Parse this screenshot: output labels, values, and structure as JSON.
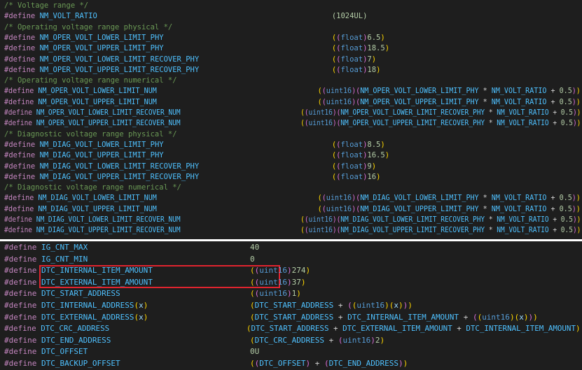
{
  "colors": {
    "background": "#1e1e1e",
    "comment": "#6a9955",
    "preprocessor": "#c586c0",
    "macro": "#4fc1ff",
    "number": "#b5cea8",
    "type": "#569cd6",
    "bracket": "#ffd700",
    "bracket_nested": "#da70d6",
    "operator": "#d4d4d4",
    "highlight_box": "#e0242f"
  },
  "editor_top": {
    "lines": [
      [
        {
          "t": "/* Voltage range */",
          "c": "comment"
        }
      ],
      [
        {
          "t": "#define",
          "c": "pp"
        },
        {
          "t": " NM_VOLT_RATIO",
          "c": "macro"
        },
        {
          "t": "(1024UL)",
          "c": "num",
          "col": 74
        }
      ],
      [
        {
          "t": "/* Operating voltage range physical */",
          "c": "comment"
        }
      ],
      [
        {
          "t": "#define",
          "c": "pp"
        },
        {
          "t": " NM_OPER_VOLT_LOWER_LIMIT_PHY",
          "c": "macro"
        },
        {
          "t": "((float)6.5)",
          "c": "expr",
          "col": 74
        }
      ],
      [
        {
          "t": "#define",
          "c": "pp"
        },
        {
          "t": " NM_OPER_VOLT_UPPER_LIMIT_PHY",
          "c": "macro"
        },
        {
          "t": "((float)18.5)",
          "c": "expr",
          "col": 74
        }
      ],
      [
        {
          "t": "#define",
          "c": "pp"
        },
        {
          "t": " NM_OPER_VOLT_LOWER_LIMIT_RECOVER_PHY",
          "c": "macro"
        },
        {
          "t": "((float)7)",
          "c": "expr",
          "col": 74
        }
      ],
      [
        {
          "t": "#define",
          "c": "pp"
        },
        {
          "t": " NM_OPER_VOLT_UPPER_LIMIT_RECOVER_PHY",
          "c": "macro"
        },
        {
          "t": "((float)18)",
          "c": "expr",
          "col": 74
        }
      ],
      [
        {
          "t": "/* Operating voltage range numerical */",
          "c": "comment"
        }
      ],
      [
        {
          "t": "#define",
          "c": "pp"
        },
        {
          "t": " NM_OPER_VOLT_LOWER_LIMIT_NUM",
          "c": "macro"
        },
        {
          "t": "((uint16)(NM_OPER_VOLT_LOWER_LIMIT_PHY * NM_VOLT_RATIO + 0.5))",
          "c": "expr",
          "col": 74
        }
      ],
      [
        {
          "t": "#define",
          "c": "pp"
        },
        {
          "t": " NM_OPER_VOLT_UPPER_LIMIT_NUM",
          "c": "macro"
        },
        {
          "t": "((uint16)(NM_OPER_VOLT_UPPER_LIMIT_PHY * NM_VOLT_RATIO + 0.5))",
          "c": "expr",
          "col": 74
        }
      ],
      [
        {
          "t": "#define",
          "c": "pp"
        },
        {
          "t": " NM_OPER_VOLT_LOWER_LIMIT_RECOVER_NUM",
          "c": "macro"
        },
        {
          "t": "((uint16)(NM_OPER_VOLT_LOWER_LIMIT_RECOVER_PHY * NM_VOLT_RATIO + 0.5))",
          "c": "expr",
          "col": 74
        }
      ],
      [
        {
          "t": "#define",
          "c": "pp"
        },
        {
          "t": " NM_OPER_VOLT_UPPER_LIMIT_RECOVER_NUM",
          "c": "macro"
        },
        {
          "t": "((uint16)(NM_OPER_VOLT_UPPER_LIMIT_RECOVER_PHY * NM_VOLT_RATIO + 0.5))",
          "c": "expr",
          "col": 74
        }
      ],
      [
        {
          "t": "/* Diagnostic voltage range physical */",
          "c": "comment"
        }
      ],
      [
        {
          "t": "#define",
          "c": "pp"
        },
        {
          "t": " NM_DIAG_VOLT_LOWER_LIMIT_PHY",
          "c": "macro"
        },
        {
          "t": "((float)8.5)",
          "c": "expr",
          "col": 74
        }
      ],
      [
        {
          "t": "#define",
          "c": "pp"
        },
        {
          "t": " NM_DIAG_VOLT_UPPER_LIMIT_PHY",
          "c": "macro"
        },
        {
          "t": "((float)16.5)",
          "c": "expr",
          "col": 74
        }
      ],
      [
        {
          "t": "#define",
          "c": "pp"
        },
        {
          "t": " NM_DIAG_VOLT_LOWER_LIMIT_RECOVER_PHY",
          "c": "macro"
        },
        {
          "t": "((float)9)",
          "c": "expr",
          "col": 74
        }
      ],
      [
        {
          "t": "#define",
          "c": "pp"
        },
        {
          "t": " NM_DIAG_VOLT_UPPER_LIMIT_RECOVER_PHY",
          "c": "macro"
        },
        {
          "t": "((float)16)",
          "c": "expr",
          "col": 74
        }
      ],
      [
        {
          "t": "/* Diagnostic voltage range numerical */",
          "c": "comment"
        }
      ],
      [
        {
          "t": "#define",
          "c": "pp"
        },
        {
          "t": " NM_DIAG_VOLT_LOWER_LIMIT_NUM",
          "c": "macro"
        },
        {
          "t": "((uint16)(NM_DIAG_VOLT_LOWER_LIMIT_PHY * NM_VOLT_RATIO + 0.5))",
          "c": "expr",
          "col": 74
        }
      ],
      [
        {
          "t": "#define",
          "c": "pp"
        },
        {
          "t": " NM_DIAG_VOLT_UPPER_LIMIT_NUM",
          "c": "macro"
        },
        {
          "t": "((uint16)(NM_DIAG_VOLT_UPPER_LIMIT_PHY * NM_VOLT_RATIO + 0.5))",
          "c": "expr",
          "col": 74
        }
      ],
      [
        {
          "t": "#define",
          "c": "pp"
        },
        {
          "t": " NM_DIAG_VOLT_LOWER_LIMIT_RECOVER_NUM",
          "c": "macro"
        },
        {
          "t": "((uint16)(NM_DIAG_VOLT_LOWER_LIMIT_RECOVER_PHY * NM_VOLT_RATIO + 0.5))",
          "c": "expr",
          "col": 74
        }
      ],
      [
        {
          "t": "#define",
          "c": "pp"
        },
        {
          "t": " NM_DIAG_VOLT_UPPER_LIMIT_RECOVER_NUM",
          "c": "macro"
        },
        {
          "t": "((uint16)(NM_DIAG_VOLT_UPPER_LIMIT_RECOVER_PHY * NM_VOLT_RATIO + 0.5))",
          "c": "expr",
          "col": 74
        }
      ]
    ]
  },
  "editor_bottom": {
    "lines": [
      [
        {
          "t": "#define",
          "c": "pp"
        },
        {
          "t": " IG_CNT_MAX",
          "c": "macro"
        },
        {
          "t": "40",
          "c": "num",
          "col": 53
        }
      ],
      [
        {
          "t": "#define",
          "c": "pp"
        },
        {
          "t": " IG_CNT_MIN",
          "c": "macro"
        },
        {
          "t": "0",
          "c": "num",
          "col": 53
        }
      ],
      [
        {
          "t": "#define",
          "c": "pp"
        },
        {
          "t": " DTC_INTERNAL_ITEM_AMOUNT",
          "c": "macro"
        },
        {
          "t": "((uint16)274)",
          "c": "expr",
          "col": 53
        }
      ],
      [
        {
          "t": "#define",
          "c": "pp"
        },
        {
          "t": " DTC_EXTERNAL_ITEM_AMOUNT",
          "c": "macro"
        },
        {
          "t": "((uint16)37)",
          "c": "expr",
          "col": 53
        }
      ],
      [
        {
          "t": "#define",
          "c": "pp"
        },
        {
          "t": " DTC_START_ADDRESS",
          "c": "macro"
        },
        {
          "t": "((uint16)1)",
          "c": "expr",
          "col": 53
        }
      ],
      [
        {
          "t": "#define",
          "c": "pp"
        },
        {
          "t": " DTC_INTERNAL_ADDRESS(x)",
          "c": "macroparam"
        },
        {
          "t": "(DTC_START_ADDRESS + ((uint16)(x)))",
          "c": "expr",
          "col": 53
        }
      ],
      [
        {
          "t": "#define",
          "c": "pp"
        },
        {
          "t": " DTC_EXTERNAL_ADDRESS(x)",
          "c": "macroparam"
        },
        {
          "t": "(DTC_START_ADDRESS + DTC_INTERNAL_ITEM_AMOUNT + ((uint16)(x)))",
          "c": "expr",
          "col": 53
        }
      ],
      [
        {
          "t": "#define",
          "c": "pp"
        },
        {
          "t": " DTC_CRC_ADDRESS",
          "c": "macro"
        },
        {
          "t": "(DTC_START_ADDRESS + DTC_EXTERNAL_ITEM_AMOUNT + DTC_INTERNAL_ITEM_AMOUNT)",
          "c": "expr",
          "col": 53
        }
      ],
      [
        {
          "t": "#define",
          "c": "pp"
        },
        {
          "t": " DTC_END_ADDRESS",
          "c": "macro"
        },
        {
          "t": "(DTC_CRC_ADDRESS + (uint16)2)",
          "c": "expr",
          "col": 53
        }
      ],
      [
        {
          "t": "#define",
          "c": "pp"
        },
        {
          "t": " DTC_OFFSET",
          "c": "macro"
        },
        {
          "t": "0U",
          "c": "num",
          "col": 53
        }
      ],
      [
        {
          "t": "#define",
          "c": "pp"
        },
        {
          "t": " DTC_BACKUP_OFFSET",
          "c": "macro"
        },
        {
          "t": "((DTC_OFFSET) + (DTC_END_ADDRESS))",
          "c": "expr",
          "col": 53
        }
      ]
    ]
  }
}
